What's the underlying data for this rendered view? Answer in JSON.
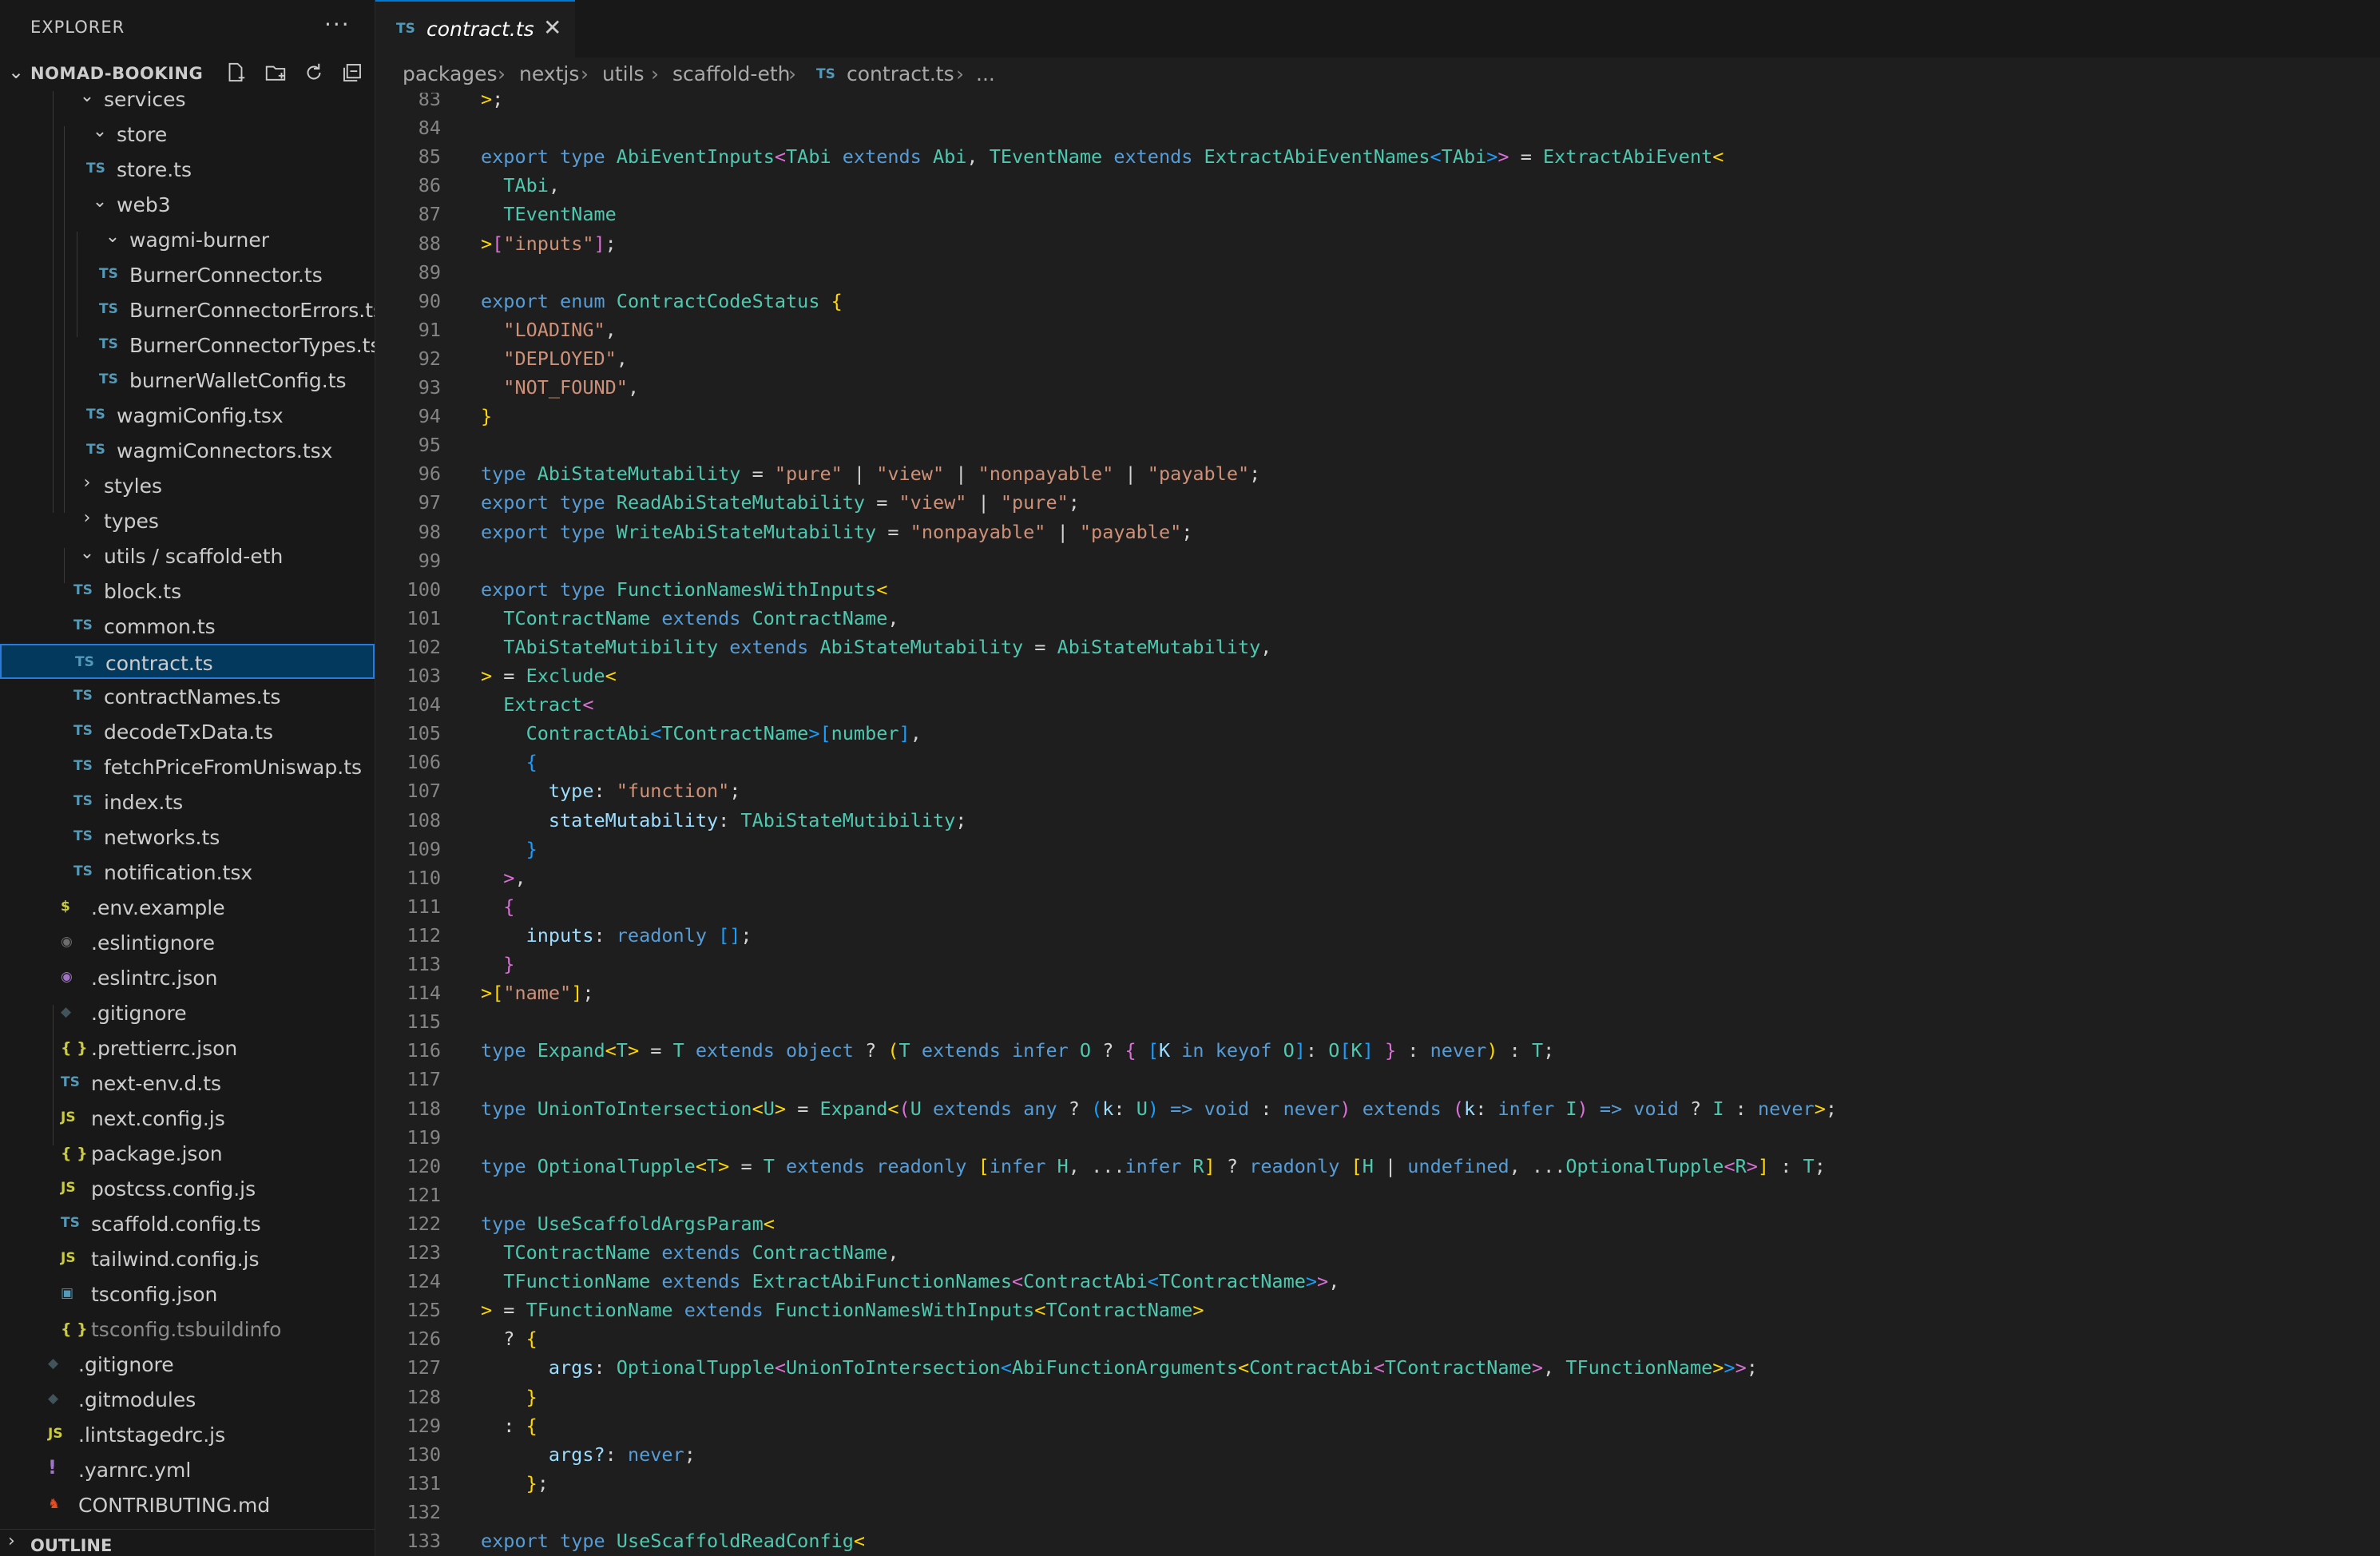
{
  "explorer": {
    "title": "EXPLORER",
    "more": "···",
    "project": "NOMAD-BOOKING",
    "outline": "OUTLINE",
    "tree": [
      {
        "name": "services",
        "depth": 2,
        "kind": "folder-open",
        "dim": false
      },
      {
        "name": "store",
        "depth": 3,
        "kind": "folder-open"
      },
      {
        "name": "store.ts",
        "depth": 3,
        "kind": "ts"
      },
      {
        "name": "web3",
        "depth": 3,
        "kind": "folder-open"
      },
      {
        "name": "wagmi-burner",
        "depth": 4,
        "kind": "folder-open"
      },
      {
        "name": "BurnerConnector.ts",
        "depth": 4,
        "kind": "ts"
      },
      {
        "name": "BurnerConnectorErrors.ts",
        "depth": 4,
        "kind": "ts"
      },
      {
        "name": "BurnerConnectorTypes.ts",
        "depth": 4,
        "kind": "ts"
      },
      {
        "name": "burnerWalletConfig.ts",
        "depth": 4,
        "kind": "ts"
      },
      {
        "name": "wagmiConfig.tsx",
        "depth": 3,
        "kind": "ts"
      },
      {
        "name": "wagmiConnectors.tsx",
        "depth": 3,
        "kind": "ts"
      },
      {
        "name": "styles",
        "depth": 2,
        "kind": "folder-closed"
      },
      {
        "name": "types",
        "depth": 2,
        "kind": "folder-closed"
      },
      {
        "name": "utils / scaffold-eth",
        "depth": 2,
        "kind": "folder-open"
      },
      {
        "name": "block.ts",
        "depth": 2,
        "kind": "ts"
      },
      {
        "name": "common.ts",
        "depth": 2,
        "kind": "ts"
      },
      {
        "name": "contract.ts",
        "depth": 2,
        "kind": "ts",
        "selected": true
      },
      {
        "name": "contractNames.ts",
        "depth": 2,
        "kind": "ts"
      },
      {
        "name": "decodeTxData.ts",
        "depth": 2,
        "kind": "ts"
      },
      {
        "name": "fetchPriceFromUniswap.ts",
        "depth": 2,
        "kind": "ts"
      },
      {
        "name": "index.ts",
        "depth": 2,
        "kind": "ts"
      },
      {
        "name": "networks.ts",
        "depth": 2,
        "kind": "ts"
      },
      {
        "name": "notification.tsx",
        "depth": 2,
        "kind": "ts"
      },
      {
        "name": ".env.example",
        "depth": 1,
        "kind": "env"
      },
      {
        "name": ".eslintignore",
        "depth": 1,
        "kind": "eslintignore"
      },
      {
        "name": ".eslintrc.json",
        "depth": 1,
        "kind": "eslint"
      },
      {
        "name": ".gitignore",
        "depth": 1,
        "kind": "git"
      },
      {
        "name": ".prettierrc.json",
        "depth": 1,
        "kind": "json"
      },
      {
        "name": "next-env.d.ts",
        "depth": 1,
        "kind": "ts"
      },
      {
        "name": "next.config.js",
        "depth": 1,
        "kind": "js"
      },
      {
        "name": "package.json",
        "depth": 1,
        "kind": "json"
      },
      {
        "name": "postcss.config.js",
        "depth": 1,
        "kind": "js"
      },
      {
        "name": "scaffold.config.ts",
        "depth": 1,
        "kind": "ts"
      },
      {
        "name": "tailwind.config.js",
        "depth": 1,
        "kind": "js"
      },
      {
        "name": "tsconfig.json",
        "depth": 1,
        "kind": "tsconfig"
      },
      {
        "name": "tsconfig.tsbuildinfo",
        "depth": 1,
        "kind": "json",
        "dim": true
      },
      {
        "name": ".gitignore",
        "depth": 0,
        "kind": "git"
      },
      {
        "name": ".gitmodules",
        "depth": 0,
        "kind": "git"
      },
      {
        "name": ".lintstagedrc.js",
        "depth": 0,
        "kind": "js"
      },
      {
        "name": ".yarnrc.yml",
        "depth": 0,
        "kind": "yml"
      },
      {
        "name": "CONTRIBUTING.md",
        "depth": 0,
        "kind": "md"
      }
    ]
  },
  "icons": {
    "ts": "TS",
    "js": "JS",
    "json": "{ }",
    "env": "$",
    "yml": "!",
    "git": "◆",
    "eslint": "◉",
    "eslintignore": "◉",
    "md": "♞",
    "tsconfig": "▣"
  },
  "colors": {
    "ts": "#519aba",
    "js": "#cbcb41",
    "json": "#cbcb41",
    "env": "#cbcb41",
    "yml": "#a074c4",
    "git": "#41535b",
    "eslint": "#a074c4",
    "eslintignore": "#6d6d6d",
    "md": "#e44d26",
    "tsconfig": "#519aba"
  },
  "tab": {
    "icon": "TS",
    "label": "contract.ts",
    "close": "✕"
  },
  "breadcrumb": [
    "packages",
    "nextjs",
    "utils",
    "scaffold-eth",
    "contract.ts",
    "..."
  ],
  "breadcrumb_icon": "TS",
  "code_start_line": 83,
  "code": [
    [
      [
        "b1",
        ">"
      ],
      [
        "op",
        ";"
      ]
    ],
    [],
    [
      [
        "kw",
        "export "
      ],
      [
        "kw",
        "type "
      ],
      [
        "ty",
        "AbiEventInputs"
      ],
      [
        "b2",
        "<"
      ],
      [
        "ty",
        "TAbi "
      ],
      [
        "kw",
        "extends "
      ],
      [
        "ty",
        "Abi"
      ],
      [
        "op",
        ", "
      ],
      [
        "ty",
        "TEventName "
      ],
      [
        "kw",
        "extends "
      ],
      [
        "ty",
        "ExtractAbiEventNames"
      ],
      [
        "b3",
        "<"
      ],
      [
        "ty",
        "TAbi"
      ],
      [
        "b3",
        ">"
      ],
      [
        "b2",
        ">"
      ],
      [
        "op",
        " = "
      ],
      [
        "ty",
        "ExtractAbiEvent"
      ],
      [
        "b1",
        "<"
      ]
    ],
    [
      [
        "op",
        "  "
      ],
      [
        "ty",
        "TAbi"
      ],
      [
        "op",
        ","
      ]
    ],
    [
      [
        "op",
        "  "
      ],
      [
        "ty",
        "TEventName"
      ]
    ],
    [
      [
        "b1",
        ">"
      ],
      [
        "b2",
        "["
      ],
      [
        "st",
        "\"inputs\""
      ],
      [
        "b2",
        "]"
      ],
      [
        "op",
        ";"
      ]
    ],
    [],
    [
      [
        "kw",
        "export "
      ],
      [
        "kw",
        "enum "
      ],
      [
        "ty",
        "ContractCodeStatus "
      ],
      [
        "b1",
        "{"
      ]
    ],
    [
      [
        "op",
        "  "
      ],
      [
        "st",
        "\"LOADING\""
      ],
      [
        "op",
        ","
      ]
    ],
    [
      [
        "op",
        "  "
      ],
      [
        "st",
        "\"DEPLOYED\""
      ],
      [
        "op",
        ","
      ]
    ],
    [
      [
        "op",
        "  "
      ],
      [
        "st",
        "\"NOT_FOUND\""
      ],
      [
        "op",
        ","
      ]
    ],
    [
      [
        "b1",
        "}"
      ]
    ],
    [],
    [
      [
        "kw",
        "type "
      ],
      [
        "ty",
        "AbiStateMutability"
      ],
      [
        "op",
        " = "
      ],
      [
        "st",
        "\"pure\""
      ],
      [
        "op",
        " | "
      ],
      [
        "st",
        "\"view\""
      ],
      [
        "op",
        " | "
      ],
      [
        "st",
        "\"nonpayable\""
      ],
      [
        "op",
        " | "
      ],
      [
        "st",
        "\"payable\""
      ],
      [
        "op",
        ";"
      ]
    ],
    [
      [
        "kw",
        "export "
      ],
      [
        "kw",
        "type "
      ],
      [
        "ty",
        "ReadAbiStateMutability"
      ],
      [
        "op",
        " = "
      ],
      [
        "st",
        "\"view\""
      ],
      [
        "op",
        " | "
      ],
      [
        "st",
        "\"pure\""
      ],
      [
        "op",
        ";"
      ]
    ],
    [
      [
        "kw",
        "export "
      ],
      [
        "kw",
        "type "
      ],
      [
        "ty",
        "WriteAbiStateMutability"
      ],
      [
        "op",
        " = "
      ],
      [
        "st",
        "\"nonpayable\""
      ],
      [
        "op",
        " | "
      ],
      [
        "st",
        "\"payable\""
      ],
      [
        "op",
        ";"
      ]
    ],
    [],
    [
      [
        "kw",
        "export "
      ],
      [
        "kw",
        "type "
      ],
      [
        "ty",
        "FunctionNamesWithInputs"
      ],
      [
        "b1",
        "<"
      ]
    ],
    [
      [
        "op",
        "  "
      ],
      [
        "ty",
        "TContractName "
      ],
      [
        "kw",
        "extends "
      ],
      [
        "ty",
        "ContractName"
      ],
      [
        "op",
        ","
      ]
    ],
    [
      [
        "op",
        "  "
      ],
      [
        "ty",
        "TAbiStateMutibility "
      ],
      [
        "kw",
        "extends "
      ],
      [
        "ty",
        "AbiStateMutability"
      ],
      [
        "op",
        " = "
      ],
      [
        "ty",
        "AbiStateMutability"
      ],
      [
        "op",
        ","
      ]
    ],
    [
      [
        "b1",
        ">"
      ],
      [
        "op",
        " = "
      ],
      [
        "ty",
        "Exclude"
      ],
      [
        "b1",
        "<"
      ]
    ],
    [
      [
        "op",
        "  "
      ],
      [
        "ty",
        "Extract"
      ],
      [
        "b2",
        "<"
      ]
    ],
    [
      [
        "op",
        "    "
      ],
      [
        "ty",
        "ContractAbi"
      ],
      [
        "b3",
        "<"
      ],
      [
        "ty",
        "TContractName"
      ],
      [
        "b3",
        ">"
      ],
      [
        "b3",
        "["
      ],
      [
        "ty",
        "number"
      ],
      [
        "b3",
        "]"
      ],
      [
        "op",
        ","
      ]
    ],
    [
      [
        "op",
        "    "
      ],
      [
        "b3",
        "{"
      ]
    ],
    [
      [
        "op",
        "      "
      ],
      [
        "pr",
        "type"
      ],
      [
        "op",
        ": "
      ],
      [
        "st",
        "\"function\""
      ],
      [
        "op",
        ";"
      ]
    ],
    [
      [
        "op",
        "      "
      ],
      [
        "pr",
        "stateMutability"
      ],
      [
        "op",
        ": "
      ],
      [
        "ty",
        "TAbiStateMutibility"
      ],
      [
        "op",
        ";"
      ]
    ],
    [
      [
        "op",
        "    "
      ],
      [
        "b3",
        "}"
      ]
    ],
    [
      [
        "op",
        "  "
      ],
      [
        "b2",
        ">"
      ],
      [
        "op",
        ","
      ]
    ],
    [
      [
        "op",
        "  "
      ],
      [
        "b2",
        "{"
      ]
    ],
    [
      [
        "op",
        "    "
      ],
      [
        "pr",
        "inputs"
      ],
      [
        "op",
        ": "
      ],
      [
        "kw",
        "readonly "
      ],
      [
        "b3",
        "[]"
      ],
      [
        "op",
        ";"
      ]
    ],
    [
      [
        "op",
        "  "
      ],
      [
        "b2",
        "}"
      ]
    ],
    [
      [
        "b1",
        ">"
      ],
      [
        "b1",
        "["
      ],
      [
        "st",
        "\"name\""
      ],
      [
        "b1",
        "]"
      ],
      [
        "op",
        ";"
      ]
    ],
    [],
    [
      [
        "kw",
        "type "
      ],
      [
        "ty",
        "Expand"
      ],
      [
        "b1",
        "<"
      ],
      [
        "ty",
        "T"
      ],
      [
        "b1",
        ">"
      ],
      [
        "op",
        " = "
      ],
      [
        "ty",
        "T "
      ],
      [
        "kw",
        "extends "
      ],
      [
        "kw",
        "object "
      ],
      [
        "op",
        "? "
      ],
      [
        "b1",
        "("
      ],
      [
        "ty",
        "T "
      ],
      [
        "kw",
        "extends "
      ],
      [
        "kw",
        "infer "
      ],
      [
        "ty",
        "O "
      ],
      [
        "op",
        "? "
      ],
      [
        "b2",
        "{ "
      ],
      [
        "b3",
        "["
      ],
      [
        "pr",
        "K "
      ],
      [
        "kw",
        "in "
      ],
      [
        "kw",
        "keyof "
      ],
      [
        "ty",
        "O"
      ],
      [
        "b3",
        "]"
      ],
      [
        "op",
        ": "
      ],
      [
        "ty",
        "O"
      ],
      [
        "b3",
        "["
      ],
      [
        "ty",
        "K"
      ],
      [
        "b3",
        "]"
      ],
      [
        "b2",
        " }"
      ],
      [
        "op",
        " : "
      ],
      [
        "kw",
        "never"
      ],
      [
        "b1",
        ")"
      ],
      [
        "op",
        " : "
      ],
      [
        "ty",
        "T"
      ],
      [
        "op",
        ";"
      ]
    ],
    [],
    [
      [
        "kw",
        "type "
      ],
      [
        "ty",
        "UnionToIntersection"
      ],
      [
        "b1",
        "<"
      ],
      [
        "ty",
        "U"
      ],
      [
        "b1",
        ">"
      ],
      [
        "op",
        " = "
      ],
      [
        "ty",
        "Expand"
      ],
      [
        "b1",
        "<"
      ],
      [
        "b2",
        "("
      ],
      [
        "ty",
        "U "
      ],
      [
        "kw",
        "extends "
      ],
      [
        "kw",
        "any "
      ],
      [
        "op",
        "? "
      ],
      [
        "b3",
        "("
      ],
      [
        "pr",
        "k"
      ],
      [
        "op",
        ": "
      ],
      [
        "ty",
        "U"
      ],
      [
        "b3",
        ")"
      ],
      [
        "kw",
        " => "
      ],
      [
        "kw",
        "void "
      ],
      [
        "op",
        ": "
      ],
      [
        "kw",
        "never"
      ],
      [
        "b2",
        ")"
      ],
      [
        "kw",
        " extends "
      ],
      [
        "b2",
        "("
      ],
      [
        "pr",
        "k"
      ],
      [
        "op",
        ": "
      ],
      [
        "kw",
        "infer "
      ],
      [
        "ty",
        "I"
      ],
      [
        "b2",
        ")"
      ],
      [
        "kw",
        " => "
      ],
      [
        "kw",
        "void "
      ],
      [
        "op",
        "? "
      ],
      [
        "ty",
        "I "
      ],
      [
        "op",
        ": "
      ],
      [
        "kw",
        "never"
      ],
      [
        "b1",
        ">"
      ],
      [
        "op",
        ";"
      ]
    ],
    [],
    [
      [
        "kw",
        "type "
      ],
      [
        "ty",
        "OptionalTupple"
      ],
      [
        "b1",
        "<"
      ],
      [
        "ty",
        "T"
      ],
      [
        "b1",
        ">"
      ],
      [
        "op",
        " = "
      ],
      [
        "ty",
        "T "
      ],
      [
        "kw",
        "extends "
      ],
      [
        "kw",
        "readonly "
      ],
      [
        "b1",
        "["
      ],
      [
        "kw",
        "infer "
      ],
      [
        "ty",
        "H"
      ],
      [
        "op",
        ", ..."
      ],
      [
        "kw",
        "infer "
      ],
      [
        "ty",
        "R"
      ],
      [
        "b1",
        "]"
      ],
      [
        "op",
        " ? "
      ],
      [
        "kw",
        "readonly "
      ],
      [
        "b1",
        "["
      ],
      [
        "ty",
        "H "
      ],
      [
        "op",
        "| "
      ],
      [
        "kw",
        "undefined"
      ],
      [
        "op",
        ", ..."
      ],
      [
        "ty",
        "OptionalTupple"
      ],
      [
        "b2",
        "<"
      ],
      [
        "ty",
        "R"
      ],
      [
        "b2",
        ">"
      ],
      [
        "b1",
        "]"
      ],
      [
        "op",
        " : "
      ],
      [
        "ty",
        "T"
      ],
      [
        "op",
        ";"
      ]
    ],
    [],
    [
      [
        "kw",
        "type "
      ],
      [
        "ty",
        "UseScaffoldArgsParam"
      ],
      [
        "b1",
        "<"
      ]
    ],
    [
      [
        "op",
        "  "
      ],
      [
        "ty",
        "TContractName "
      ],
      [
        "kw",
        "extends "
      ],
      [
        "ty",
        "ContractName"
      ],
      [
        "op",
        ","
      ]
    ],
    [
      [
        "op",
        "  "
      ],
      [
        "ty",
        "TFunctionName "
      ],
      [
        "kw",
        "extends "
      ],
      [
        "ty",
        "ExtractAbiFunctionNames"
      ],
      [
        "b2",
        "<"
      ],
      [
        "ty",
        "ContractAbi"
      ],
      [
        "b3",
        "<"
      ],
      [
        "ty",
        "TContractName"
      ],
      [
        "b3",
        ">"
      ],
      [
        "b2",
        ">"
      ],
      [
        "op",
        ","
      ]
    ],
    [
      [
        "b1",
        ">"
      ],
      [
        "op",
        " = "
      ],
      [
        "ty",
        "TFunctionName "
      ],
      [
        "kw",
        "extends "
      ],
      [
        "ty",
        "FunctionNamesWithInputs"
      ],
      [
        "b1",
        "<"
      ],
      [
        "ty",
        "TContractName"
      ],
      [
        "b1",
        ">"
      ]
    ],
    [
      [
        "op",
        "  ? "
      ],
      [
        "b1",
        "{"
      ]
    ],
    [
      [
        "op",
        "      "
      ],
      [
        "pr",
        "args"
      ],
      [
        "op",
        ": "
      ],
      [
        "ty",
        "OptionalTupple"
      ],
      [
        "b2",
        "<"
      ],
      [
        "ty",
        "UnionToIntersection"
      ],
      [
        "b3",
        "<"
      ],
      [
        "ty",
        "AbiFunctionArguments"
      ],
      [
        "b1",
        "<"
      ],
      [
        "ty",
        "ContractAbi"
      ],
      [
        "b2",
        "<"
      ],
      [
        "ty",
        "TContractName"
      ],
      [
        "b2",
        ">"
      ],
      [
        "op",
        ", "
      ],
      [
        "ty",
        "TFunctionName"
      ],
      [
        "b1",
        ">"
      ],
      [
        "b3",
        ">"
      ],
      [
        "b2",
        ">"
      ],
      [
        "op",
        ";"
      ]
    ],
    [
      [
        "op",
        "    "
      ],
      [
        "b1",
        "}"
      ]
    ],
    [
      [
        "op",
        "  : "
      ],
      [
        "b1",
        "{"
      ]
    ],
    [
      [
        "op",
        "      "
      ],
      [
        "pr",
        "args?"
      ],
      [
        "op",
        ": "
      ],
      [
        "kw",
        "never"
      ],
      [
        "op",
        ";"
      ]
    ],
    [
      [
        "op",
        "    "
      ],
      [
        "b1",
        "}"
      ],
      [
        "op",
        ";"
      ]
    ],
    [],
    [
      [
        "kw",
        "export "
      ],
      [
        "kw",
        "type "
      ],
      [
        "ty",
        "UseScaffoldReadConfig"
      ],
      [
        "b1",
        "<"
      ]
    ]
  ]
}
